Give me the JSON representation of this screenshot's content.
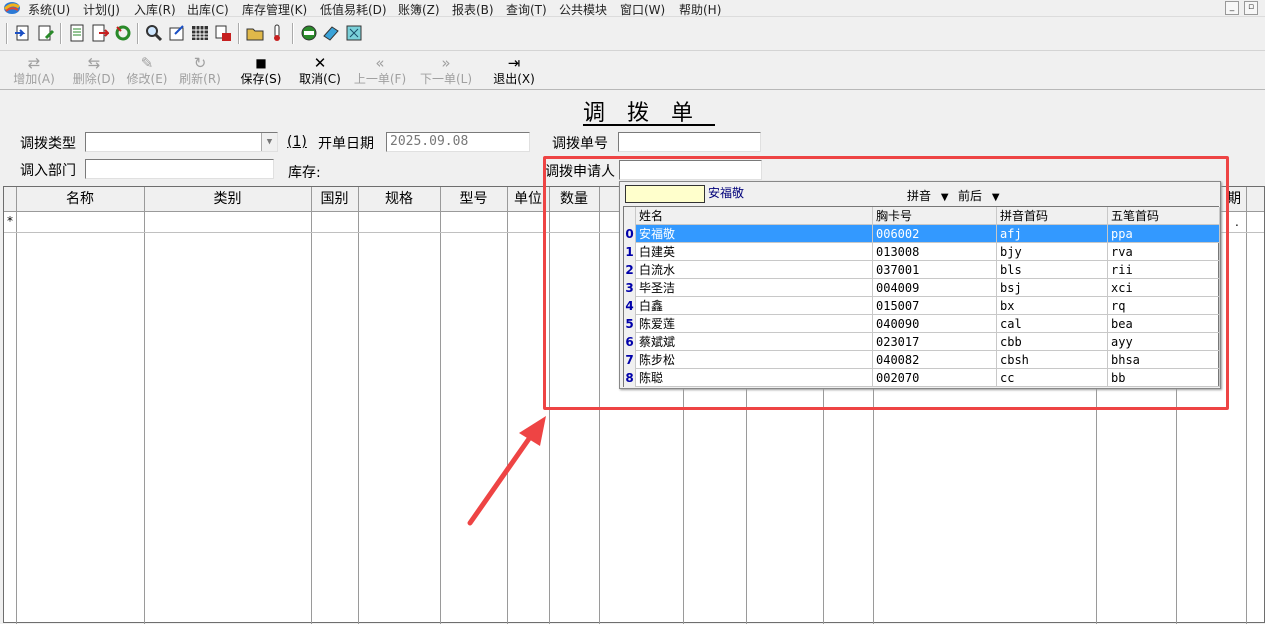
{
  "menu": [
    "系统(U)",
    "计划(J)",
    "入库(R)",
    "出库(C)",
    "库存管理(K)",
    "低值易耗(D)",
    "账簿(Z)",
    "报表(B)",
    "查询(T)",
    "公共模块",
    "窗口(W)",
    "帮助(H)"
  ],
  "window_controls": [
    "_",
    "▫"
  ],
  "toolbar_icons": [
    "import-icon",
    "edit-doc-icon",
    "report-icon",
    "export-icon",
    "recycle-icon",
    "search-icon",
    "form-icon",
    "grid-icon",
    "print-icon",
    "folder-icon",
    "thermometer-icon",
    "minus-circle-icon",
    "book-icon",
    "calculator-icon"
  ],
  "actions": [
    {
      "glyph": "⇄",
      "label": "增加(A)",
      "enabled": false
    },
    {
      "glyph": "⇆",
      "label": "删除(D)",
      "enabled": false
    },
    {
      "glyph": "✎",
      "label": "修改(E)",
      "enabled": false
    },
    {
      "glyph": "↻",
      "label": "刷新(R)",
      "enabled": false
    },
    {
      "glyph": "■",
      "label": "保存(S)",
      "enabled": true
    },
    {
      "glyph": "✕",
      "label": "取消(C)",
      "enabled": true
    },
    {
      "glyph": "«",
      "label": "上一单(F)",
      "enabled": false
    },
    {
      "glyph": "»",
      "label": "下一单(L)",
      "enabled": false
    },
    {
      "glyph": "⇥",
      "label": "退出(X)",
      "enabled": true
    }
  ],
  "form": {
    "title": "调拨单",
    "transfer_type_label": "调拨类型",
    "transfer_type_value": "",
    "one_marker": "(1)",
    "open_date_label": "开单日期",
    "open_date_value": "2025.09.08",
    "transfer_no_label": "调拨单号",
    "transfer_no_value": "",
    "dept_label": "调入部门",
    "dept_value": "",
    "stock_label": "库存:",
    "applicant_label": "调拨申请人",
    "applicant_value": ""
  },
  "grid": {
    "row_marker": "*",
    "columns": [
      "名称",
      "类别",
      "国别",
      "规格",
      "型号",
      "单位",
      "数量",
      "",
      "",
      "",
      "",
      "",
      "",
      "",
      "期"
    ],
    "trailing_dot": "."
  },
  "popup": {
    "search_value": "",
    "current_value": "安福敬",
    "mode_pinyin": "拼音",
    "mode_position": "前后",
    "columns": [
      "姓名",
      "胸卡号",
      "拼音首码",
      "五笔首码"
    ],
    "rows": [
      {
        "idx": "0",
        "name": "安福敬",
        "card": "006002",
        "pinyin": "afj",
        "wubi": "ppa",
        "selected": true
      },
      {
        "idx": "1",
        "name": "白建英",
        "card": "013008",
        "pinyin": "bjy",
        "wubi": "rva"
      },
      {
        "idx": "2",
        "name": "白流水",
        "card": "037001",
        "pinyin": "bls",
        "wubi": "rii"
      },
      {
        "idx": "3",
        "name": "毕圣洁",
        "card": "004009",
        "pinyin": "bsj",
        "wubi": "xci"
      },
      {
        "idx": "4",
        "name": "白鑫",
        "card": "015007",
        "pinyin": "bx",
        "wubi": "rq"
      },
      {
        "idx": "5",
        "name": "陈爱莲",
        "card": "040090",
        "pinyin": "cal",
        "wubi": "bea"
      },
      {
        "idx": "6",
        "name": "蔡斌斌",
        "card": "023017",
        "pinyin": "cbb",
        "wubi": "ayy"
      },
      {
        "idx": "7",
        "name": "陈步松",
        "card": "040082",
        "pinyin": "cbsh",
        "wubi": "bhsa"
      },
      {
        "idx": "8",
        "name": "陈聪",
        "card": "002070",
        "pinyin": "cc",
        "wubi": "bb"
      }
    ]
  },
  "colors": {
    "highlight": "#ee4444",
    "selected_row": "#3399ff",
    "popup_search": "#ffffcc"
  }
}
